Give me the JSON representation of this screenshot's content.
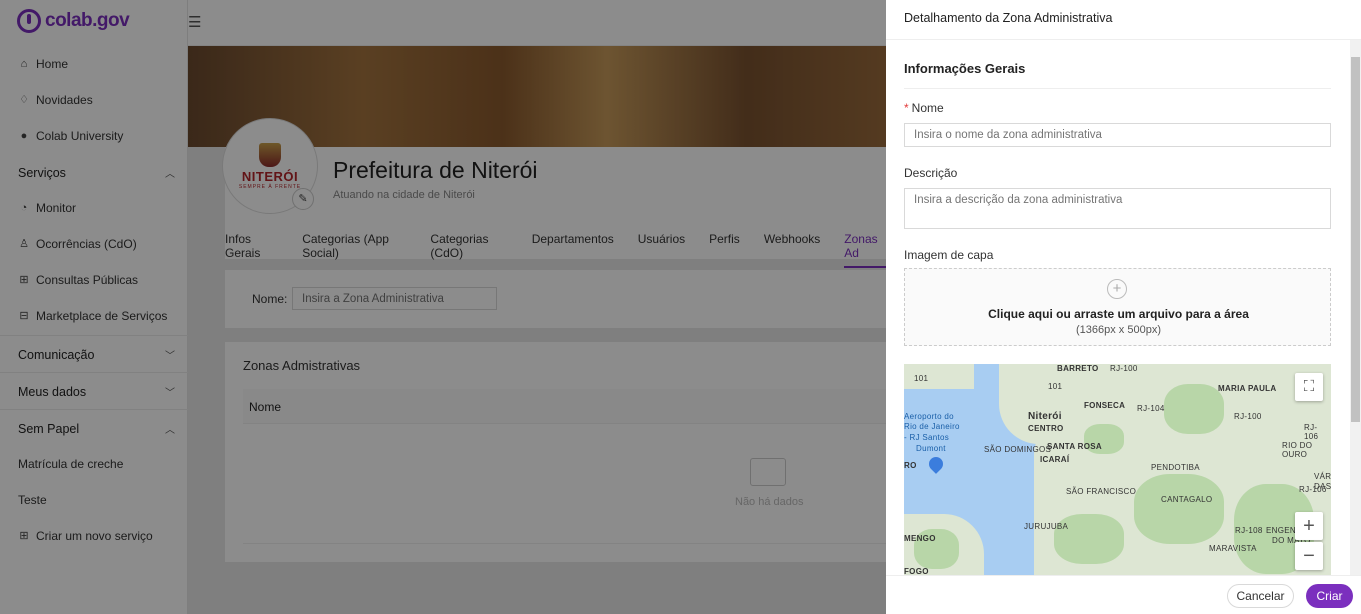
{
  "app": {
    "logo_text": "colab.gov"
  },
  "sidebar": {
    "items": [
      {
        "label": "Home",
        "icon": "home-icon"
      },
      {
        "label": "Novidades",
        "icon": "bell-icon"
      },
      {
        "label": "Colab University",
        "icon": "university-icon"
      }
    ],
    "sections": [
      {
        "label": "Serviços",
        "expanded": true,
        "items": [
          {
            "label": "Monitor",
            "icon": "monitor-icon"
          },
          {
            "label": "Ocorrências (CdO)",
            "icon": "alert-icon"
          },
          {
            "label": "Consultas Públicas",
            "icon": "consult-icon"
          },
          {
            "label": "Marketplace de Serviços",
            "icon": "marketplace-icon"
          }
        ]
      },
      {
        "label": "Comunicação",
        "expanded": false
      },
      {
        "label": "Meus dados",
        "expanded": false
      },
      {
        "label": "Sem Papel",
        "expanded": true,
        "items": [
          {
            "label": "Matrícula de creche"
          },
          {
            "label": "Teste"
          },
          {
            "label": "Criar um novo serviço",
            "icon": "new-service-icon"
          }
        ]
      }
    ]
  },
  "profile": {
    "avatar_name": "NITERÓI",
    "avatar_sub": "SEMPRE À FRENTE",
    "title": "Prefeitura de Niterói",
    "subtitle": "Atuando na cidade de Niterói"
  },
  "tabs": [
    "Infos Gerais",
    "Categorias (App Social)",
    "Categorias (CdO)",
    "Departamentos",
    "Usuários",
    "Perfis",
    "Webhooks",
    "Zonas Ad"
  ],
  "filter": {
    "label": "Nome:",
    "placeholder": "Insira a Zona Administrativa"
  },
  "list": {
    "title": "Zonas Admistrativas",
    "column": "Nome",
    "empty": "Não há dados"
  },
  "drawer": {
    "title": "Detalhamento da Zona Administrativa",
    "section": "Informações Gerais",
    "name_label": "Nome",
    "name_placeholder": "Insira o nome da zona administrativa",
    "desc_label": "Descrição",
    "desc_placeholder": "Insira a descrição da zona administrativa",
    "cover_label": "Imagem de capa",
    "upload_text": "Clique aqui ou arraste um arquivo para a área",
    "upload_sub": "(1366px x 500px)",
    "cancel": "Cancelar",
    "create": "Criar"
  },
  "map": {
    "labels": [
      "BARRETO",
      "RJ-100",
      "MARIA PAULA",
      "101",
      "101",
      "Niterói",
      "CENTRO",
      "FONSECA",
      "RJ-104",
      "RJ-100",
      "RJ-106",
      "Aeroporto do",
      "Rio de Janeiro",
      "- RJ Santos",
      "Dumont",
      "SÃO DOMINGOS",
      "SANTA ROSA",
      "ICARAÍ",
      "RIO DO OURO",
      "RO",
      "PENDOTIBA",
      "VÁRZEA",
      "DAS",
      "SÃO FRANCISCO",
      "CANTAGALO",
      "RJ-106",
      "RJ-108",
      "JURUJUBA",
      "MENGO",
      "ENGENHO",
      "DO MATO",
      "MARAVISTA",
      "FOGO"
    ],
    "colors": {
      "water": "#a8cdf2",
      "land": "#dde6d3",
      "park": "#b8d6a8"
    }
  },
  "colors": {
    "accent": "#7b2fbe",
    "required": "#e23b3b"
  }
}
